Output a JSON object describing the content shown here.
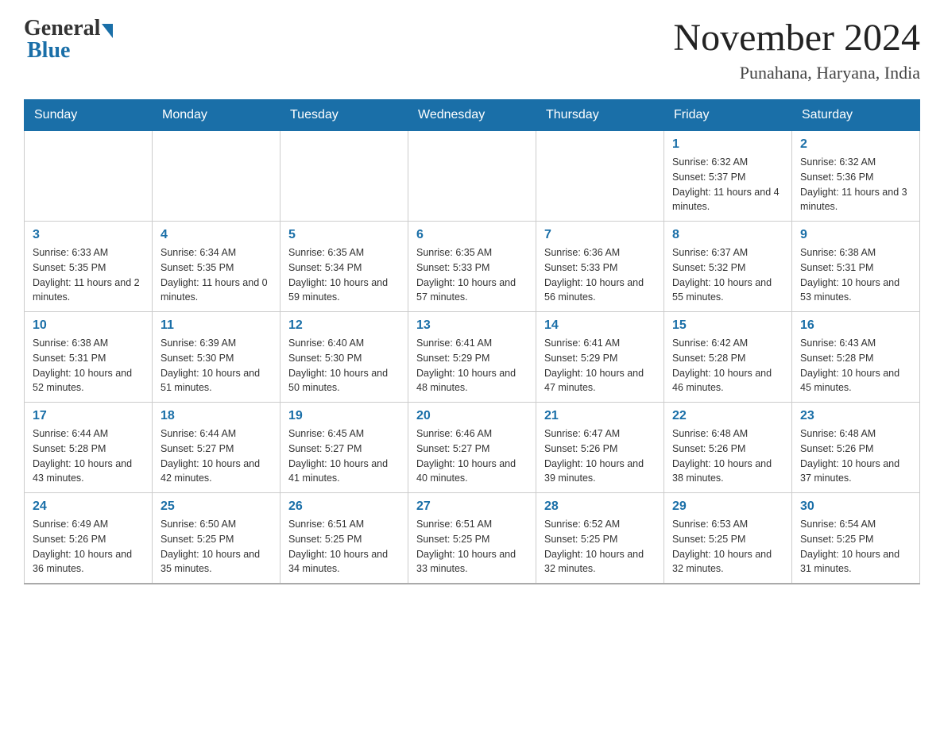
{
  "header": {
    "logo_general": "General",
    "logo_blue": "Blue",
    "month_title": "November 2024",
    "location": "Punahana, Haryana, India"
  },
  "days_of_week": [
    "Sunday",
    "Monday",
    "Tuesday",
    "Wednesday",
    "Thursday",
    "Friday",
    "Saturday"
  ],
  "weeks": [
    [
      {
        "day": "",
        "info": ""
      },
      {
        "day": "",
        "info": ""
      },
      {
        "day": "",
        "info": ""
      },
      {
        "day": "",
        "info": ""
      },
      {
        "day": "",
        "info": ""
      },
      {
        "day": "1",
        "info": "Sunrise: 6:32 AM\nSunset: 5:37 PM\nDaylight: 11 hours and 4 minutes."
      },
      {
        "day": "2",
        "info": "Sunrise: 6:32 AM\nSunset: 5:36 PM\nDaylight: 11 hours and 3 minutes."
      }
    ],
    [
      {
        "day": "3",
        "info": "Sunrise: 6:33 AM\nSunset: 5:35 PM\nDaylight: 11 hours and 2 minutes."
      },
      {
        "day": "4",
        "info": "Sunrise: 6:34 AM\nSunset: 5:35 PM\nDaylight: 11 hours and 0 minutes."
      },
      {
        "day": "5",
        "info": "Sunrise: 6:35 AM\nSunset: 5:34 PM\nDaylight: 10 hours and 59 minutes."
      },
      {
        "day": "6",
        "info": "Sunrise: 6:35 AM\nSunset: 5:33 PM\nDaylight: 10 hours and 57 minutes."
      },
      {
        "day": "7",
        "info": "Sunrise: 6:36 AM\nSunset: 5:33 PM\nDaylight: 10 hours and 56 minutes."
      },
      {
        "day": "8",
        "info": "Sunrise: 6:37 AM\nSunset: 5:32 PM\nDaylight: 10 hours and 55 minutes."
      },
      {
        "day": "9",
        "info": "Sunrise: 6:38 AM\nSunset: 5:31 PM\nDaylight: 10 hours and 53 minutes."
      }
    ],
    [
      {
        "day": "10",
        "info": "Sunrise: 6:38 AM\nSunset: 5:31 PM\nDaylight: 10 hours and 52 minutes."
      },
      {
        "day": "11",
        "info": "Sunrise: 6:39 AM\nSunset: 5:30 PM\nDaylight: 10 hours and 51 minutes."
      },
      {
        "day": "12",
        "info": "Sunrise: 6:40 AM\nSunset: 5:30 PM\nDaylight: 10 hours and 50 minutes."
      },
      {
        "day": "13",
        "info": "Sunrise: 6:41 AM\nSunset: 5:29 PM\nDaylight: 10 hours and 48 minutes."
      },
      {
        "day": "14",
        "info": "Sunrise: 6:41 AM\nSunset: 5:29 PM\nDaylight: 10 hours and 47 minutes."
      },
      {
        "day": "15",
        "info": "Sunrise: 6:42 AM\nSunset: 5:28 PM\nDaylight: 10 hours and 46 minutes."
      },
      {
        "day": "16",
        "info": "Sunrise: 6:43 AM\nSunset: 5:28 PM\nDaylight: 10 hours and 45 minutes."
      }
    ],
    [
      {
        "day": "17",
        "info": "Sunrise: 6:44 AM\nSunset: 5:28 PM\nDaylight: 10 hours and 43 minutes."
      },
      {
        "day": "18",
        "info": "Sunrise: 6:44 AM\nSunset: 5:27 PM\nDaylight: 10 hours and 42 minutes."
      },
      {
        "day": "19",
        "info": "Sunrise: 6:45 AM\nSunset: 5:27 PM\nDaylight: 10 hours and 41 minutes."
      },
      {
        "day": "20",
        "info": "Sunrise: 6:46 AM\nSunset: 5:27 PM\nDaylight: 10 hours and 40 minutes."
      },
      {
        "day": "21",
        "info": "Sunrise: 6:47 AM\nSunset: 5:26 PM\nDaylight: 10 hours and 39 minutes."
      },
      {
        "day": "22",
        "info": "Sunrise: 6:48 AM\nSunset: 5:26 PM\nDaylight: 10 hours and 38 minutes."
      },
      {
        "day": "23",
        "info": "Sunrise: 6:48 AM\nSunset: 5:26 PM\nDaylight: 10 hours and 37 minutes."
      }
    ],
    [
      {
        "day": "24",
        "info": "Sunrise: 6:49 AM\nSunset: 5:26 PM\nDaylight: 10 hours and 36 minutes."
      },
      {
        "day": "25",
        "info": "Sunrise: 6:50 AM\nSunset: 5:25 PM\nDaylight: 10 hours and 35 minutes."
      },
      {
        "day": "26",
        "info": "Sunrise: 6:51 AM\nSunset: 5:25 PM\nDaylight: 10 hours and 34 minutes."
      },
      {
        "day": "27",
        "info": "Sunrise: 6:51 AM\nSunset: 5:25 PM\nDaylight: 10 hours and 33 minutes."
      },
      {
        "day": "28",
        "info": "Sunrise: 6:52 AM\nSunset: 5:25 PM\nDaylight: 10 hours and 32 minutes."
      },
      {
        "day": "29",
        "info": "Sunrise: 6:53 AM\nSunset: 5:25 PM\nDaylight: 10 hours and 32 minutes."
      },
      {
        "day": "30",
        "info": "Sunrise: 6:54 AM\nSunset: 5:25 PM\nDaylight: 10 hours and 31 minutes."
      }
    ]
  ]
}
